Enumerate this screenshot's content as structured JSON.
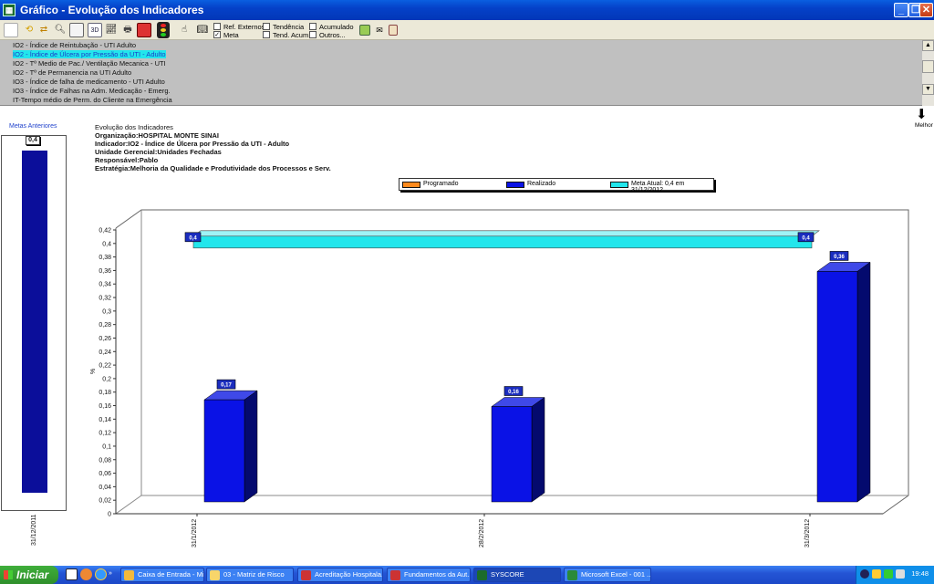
{
  "window": {
    "title": "Gráfico - Evolução dos Indicadores",
    "min_label": "_",
    "restore_label": "❐",
    "close_label": "✕"
  },
  "toolbar": {
    "btn_3d": "3D",
    "checks": [
      {
        "label": "Ref. Externos",
        "checked": false
      },
      {
        "label": "Meta",
        "checked": true
      },
      {
        "label": "Tendência",
        "checked": false
      },
      {
        "label": "Tend. Acum.",
        "checked": false
      },
      {
        "label": "Acumulado",
        "checked": false
      },
      {
        "label": "Outros...",
        "checked": false
      }
    ]
  },
  "indicator_list": [
    "IO2 - Índice de Reintubação - UTI Adulto",
    "IO2 - Índice de Úlcera por Pressão da UTI - Adulto",
    "IO2 - Tº Medio de Pac./ Ventilação Mecanica - UTI",
    "IO2 - Tº de Permanencia na UTI Adulto",
    "IO3 - Índice de falha de medicamento - UTI Adulto",
    "IO3 - Índice de Falhas na Adm. Medicação - Emerg.",
    "IT-Tempo médio de Perm. do Cliente na Emergência"
  ],
  "selected_index": 1,
  "scroll": {
    "up": "▲",
    "down": "▼"
  },
  "header": {
    "title": "Evolução dos Indicadores",
    "org_label": "Organização:",
    "org_value": "HOSPITAL MONTE SINAI",
    "ind_label": "Indicador:",
    "ind_value": "IO2 - Índice de Úlcera por Pressão da UTI - Adulto",
    "unit_label": "Unidade Gerencial:",
    "unit_value": "Unidades Fechadas",
    "resp_label": "Responsável:",
    "resp_value": "Pablo",
    "strat_label": "Estratégia:",
    "strat_value": "Melhoria da Qualidade e Produtividade dos Processos e Serv."
  },
  "side": {
    "title": "Metas Anteriores",
    "value_label": "0,4",
    "value": 0.4,
    "date": "31/12/2011"
  },
  "better": {
    "arrow": "⬇",
    "label": "Melhor"
  },
  "chart_data": {
    "type": "bar",
    "categories": [
      "31/1/2012",
      "28/2/2012",
      "31/3/2012"
    ],
    "series": [
      {
        "name": "Realizado",
        "values": [
          0.17,
          0.16,
          0.36
        ],
        "color": "#0a12e6",
        "labels": [
          "0,17",
          "0,16",
          "0,36"
        ]
      }
    ],
    "meta": {
      "value": 0.4,
      "label": "0,4",
      "color": "#22e6ec"
    },
    "legend": [
      {
        "label": "Programado",
        "color": "#ff8a1c"
      },
      {
        "label": "Realizado",
        "color": "#0a12e6"
      },
      {
        "label": "Meta Atual: 0,4 em 31/12/2012",
        "color": "#22e6ec"
      }
    ],
    "yticks": [
      "0",
      "0,02",
      "0,04",
      "0,06",
      "0,08",
      "0,1",
      "0,12",
      "0,14",
      "0,16",
      "0,18",
      "0,2",
      "0,22",
      "0,24",
      "0,26",
      "0,28",
      "0,3",
      "0,32",
      "0,34",
      "0,36",
      "0,38",
      "0,4",
      "0,42"
    ],
    "ylim": [
      0,
      0.42
    ],
    "ylabel": "%",
    "grid": false
  },
  "taskbar": {
    "start": "Iniciar",
    "tasks": [
      "Caixa de Entrada - Mi...",
      "03 - Matriz de Risco",
      "Acreditação Hospitala...",
      "Fundamentos da Aut...",
      "SYSCORE",
      "Microsoft Excel - 001 ..."
    ],
    "active_index": 4,
    "clock": "19:48"
  }
}
